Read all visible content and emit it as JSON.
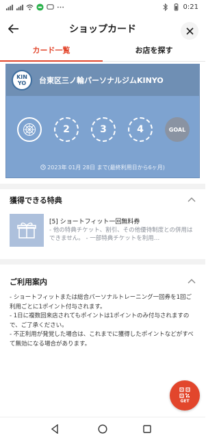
{
  "status_bar": {
    "time": "0:21"
  },
  "header": {
    "title": "ショップカード"
  },
  "tabs": [
    {
      "label": "カード一覧",
      "active": true
    },
    {
      "label": "お店を探す",
      "active": false
    }
  ],
  "card": {
    "logo_text_top": "KIN",
    "logo_text_bottom": "YO",
    "store_name": "台東区三ノ輪パーソナルジムKINYO",
    "stamps": [
      "",
      "2",
      "3",
      "4",
      "GOAL"
    ],
    "stamps_collected": 1,
    "expiry": "2023年 01月 28日 まで(最終利用日から6ヶ月)",
    "colors": {
      "card_bg": "#7ea3d0",
      "head_bg": "#6f8fb4",
      "goal_bg": "#8a93a2"
    }
  },
  "benefits": {
    "title": "獲得できる特典",
    "items": [
      {
        "title": "[5] ショートフィット一回無料券",
        "desc": "- 他の特典チケット、割引、その他優待制度との併用はできません。 - 一部特典チケットを利用…"
      }
    ]
  },
  "guide": {
    "title": "ご利用案内",
    "lines": [
      "- ショートフィットまたは総合パーソナルトレーニング一回券を1回ご利用ごとに1ポイント付与されます。",
      "- 1日に複数回来店されてもポイントは1ポイントのみ付与されますので、ご了承ください。",
      "- 不正利用が発覚した場合は、これまでに獲得したポイントなどがすべて無効になる場合があります。"
    ]
  },
  "get_button": {
    "label": "GET"
  },
  "accent_color": "#e2462c"
}
